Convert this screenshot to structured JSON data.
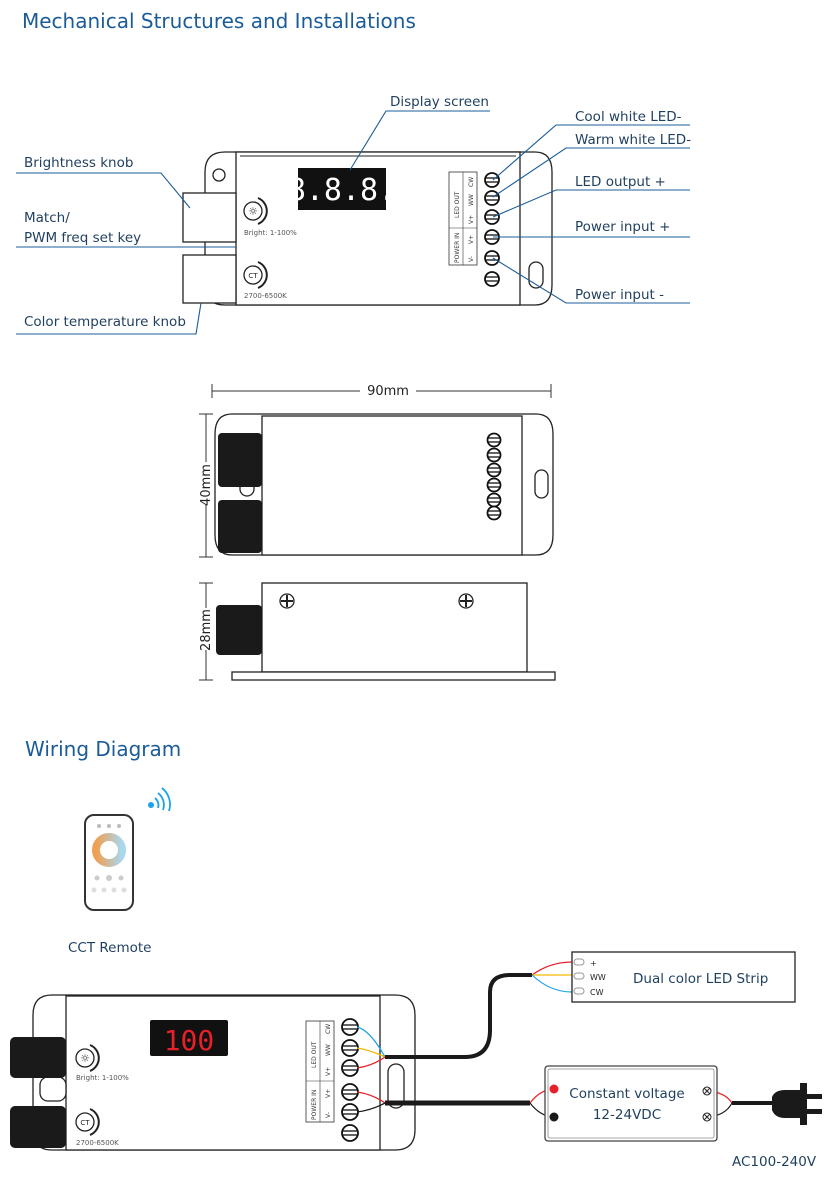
{
  "sections": {
    "mechanical_title": "Mechanical Structures and Installations",
    "wiring_title": "Wiring Diagram"
  },
  "callouts": {
    "display_screen": "Display screen",
    "brightness_knob": "Brightness knob",
    "match_line1": "Match/",
    "match_line2": "PWM freq set key",
    "color_temp_knob": "Color temperature knob",
    "cool_white": "Cool white LED-",
    "warm_white": "Warm white LED-",
    "led_output": "LED output +",
    "power_plus": "Power input +",
    "power_minus": "Power input -"
  },
  "device": {
    "display_top": "8.8.8.",
    "display_wiring": "100",
    "bright_label": "Bright: 1-100%",
    "ct_button": "CT",
    "ct_range": "2700-6500K",
    "led_out": "LED OUT",
    "power_in": "POWER IN",
    "cw": "CW",
    "ww": "WW",
    "vplus": "V+",
    "vminus": "V-"
  },
  "dimensions": {
    "width": "90mm",
    "height": "40mm",
    "depth": "28mm"
  },
  "wiring": {
    "remote_label": "CCT Remote",
    "strip_label": "Dual color LED Strip",
    "strip_plus": "+",
    "strip_ww": "WW",
    "strip_cw": "CW",
    "psu_line1": "Constant voltage",
    "psu_line2": "12-24VDC",
    "ac_label": "AC100-240V",
    "colors": {
      "red": "#e8202a",
      "yellow": "#f5b800",
      "blue": "#1aa3e8",
      "black": "#1a1a1a"
    }
  }
}
